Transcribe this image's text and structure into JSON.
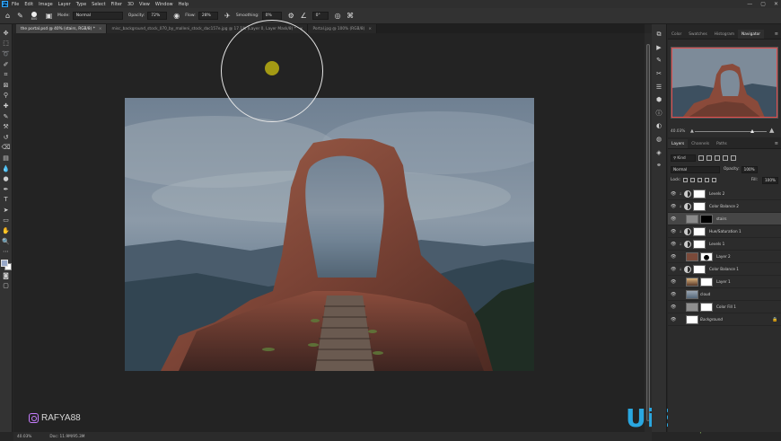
{
  "menu": {
    "logo": "Ps",
    "items": [
      "File",
      "Edit",
      "Image",
      "Layer",
      "Type",
      "Select",
      "Filter",
      "3D",
      "View",
      "Window",
      "Help"
    ]
  },
  "window_controls": {
    "minimize": "—",
    "restore": "▢",
    "close": "✕"
  },
  "options": {
    "brush_size": "800",
    "mode_label": "Mode:",
    "mode_value": "Normal",
    "opacity_label": "Opacity:",
    "opacity_value": "72%",
    "flow_label": "Flow:",
    "flow_value": "28%",
    "smoothing_label": "Smoothing:",
    "smoothing_value": "0%",
    "angle_value": "0°"
  },
  "tabs": [
    {
      "label": "the portal.psd @ 40% (stairs, RGB/8) *",
      "active": true
    },
    {
      "label": "misc_background_stock_070_by_malleni_stock_dac157e.jpg @ 17.1% (Layer 0, Layer Mask/8) *",
      "active": false
    },
    {
      "label": "Portal.jpg @ 100% (RGB/8)",
      "active": false
    }
  ],
  "status": {
    "zoom": "40.03%",
    "doc": "Doc: 11.9M/95.3M"
  },
  "watermark": {
    "instagram": "RAFYA88",
    "site": "UiBQ.CoM",
    "site_sub": "www.psahz.com"
  },
  "navigator_panel": {
    "tabs": [
      "Color",
      "Swatches",
      "Histogram",
      "Navigator"
    ],
    "active_tab": "Navigator",
    "zoom": "40.03%"
  },
  "layers_panel": {
    "tabs": [
      "Layers",
      "Channels",
      "Paths"
    ],
    "active_tab": "Layers",
    "kind": "Kind",
    "blend_mode": "Normal",
    "opacity_label": "Opacity:",
    "opacity_value": "100%",
    "lock_label": "Lock:",
    "fill_label": "Fill:",
    "fill_value": "100%",
    "layers": [
      {
        "name": "Levels 2",
        "type": "adjustment",
        "selected": false
      },
      {
        "name": "Color Balance 2",
        "type": "adjustment",
        "selected": false
      },
      {
        "name": "stairs",
        "type": "image-mask",
        "selected": true
      },
      {
        "name": "Hue/Saturation 1",
        "type": "adjustment",
        "selected": false
      },
      {
        "name": "Levels 1",
        "type": "adjustment",
        "selected": false
      },
      {
        "name": "Layer 2",
        "type": "image-mask",
        "selected": false
      },
      {
        "name": "Color Balance 1",
        "type": "adjustment",
        "selected": false
      },
      {
        "name": "Layer 1",
        "type": "image-mask",
        "selected": false
      },
      {
        "name": "cloud",
        "type": "image",
        "selected": false
      },
      {
        "name": "Color Fill 1",
        "type": "fill",
        "selected": false
      },
      {
        "name": "Background",
        "type": "background",
        "selected": false
      }
    ]
  },
  "colors": {
    "accent_red": "#e34b4b",
    "brush_center": "#a39a14",
    "uibo_blue": "#2aa7e0"
  }
}
